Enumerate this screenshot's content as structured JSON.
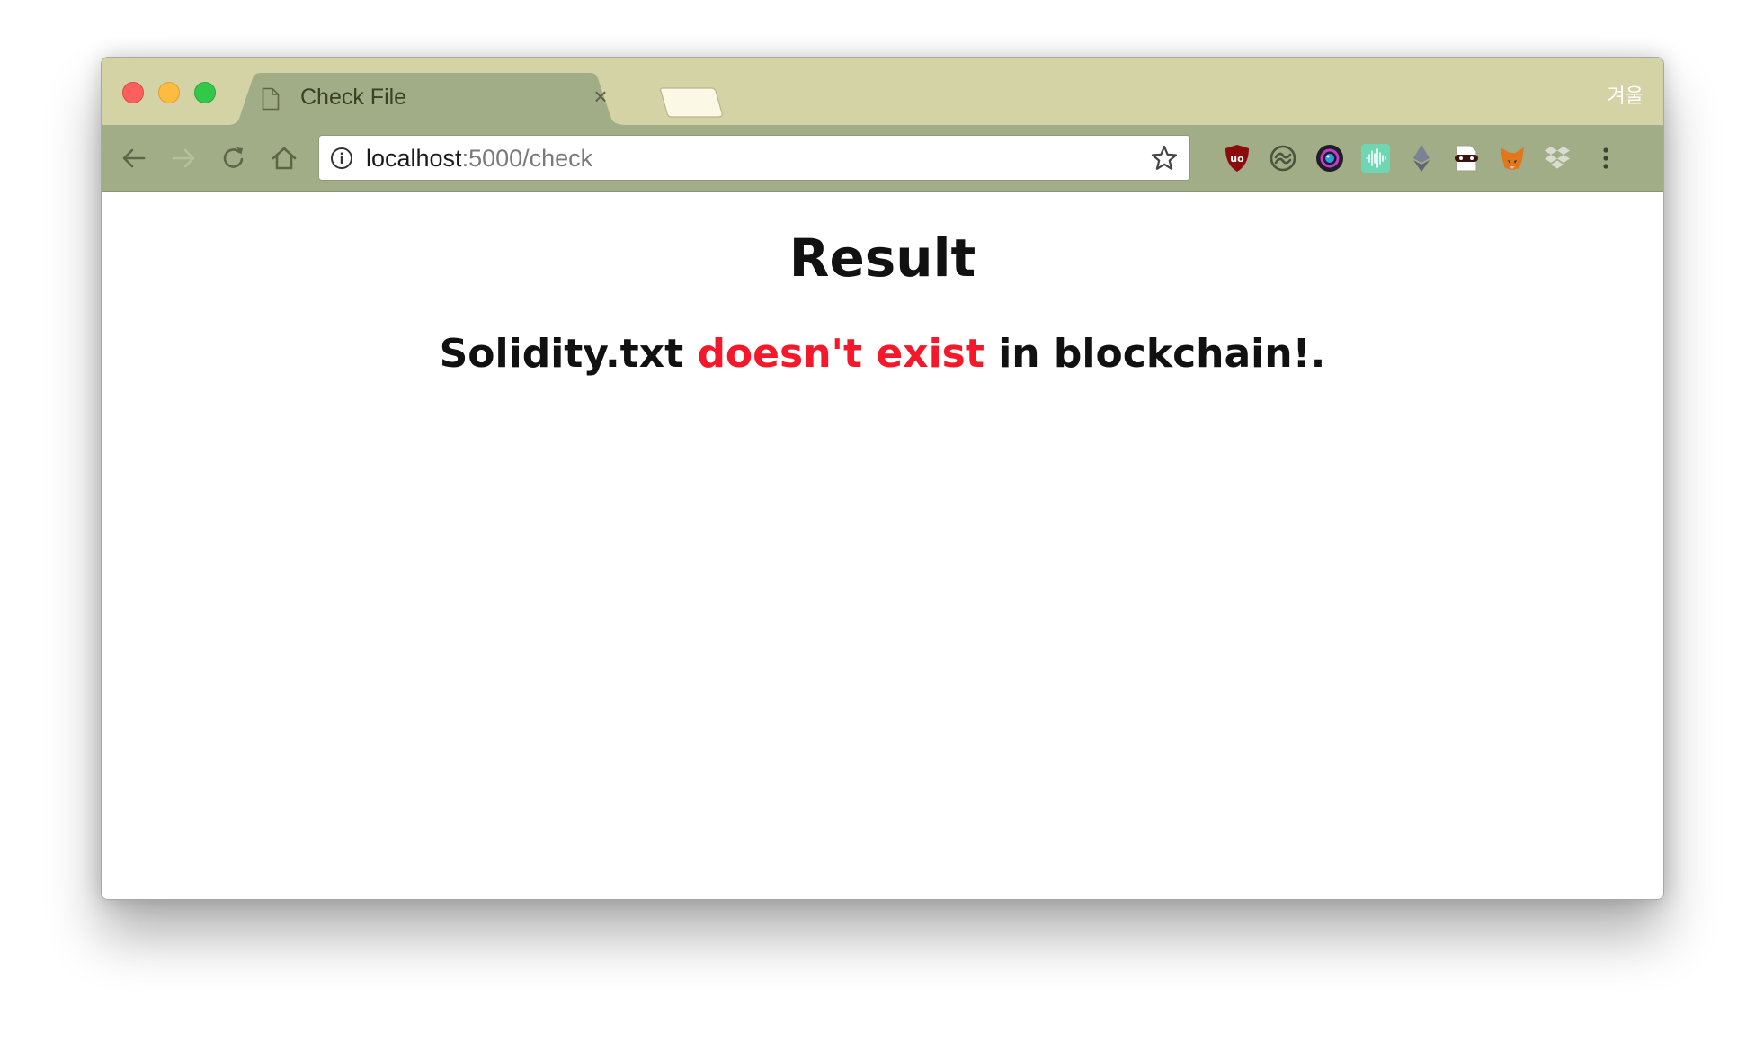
{
  "browser": {
    "tab_title": "Check File",
    "tab_close": "×",
    "profile_name": "겨울",
    "url_host": "localhost",
    "url_rest": ":5000/check",
    "icons": {
      "back": "arrow-left-icon",
      "forward": "arrow-right-icon",
      "reload": "reload-icon",
      "home": "home-icon",
      "site_info": "info-icon",
      "bookmark": "star-icon",
      "menu": "vertical-dots-icon"
    },
    "extensions": [
      "ublock-icon",
      "sync-icon",
      "camera-lens-icon",
      "audio-wave-icon",
      "ethereum-icon",
      "masked-extension-icon",
      "metamask-fox-icon",
      "dropbox-icon"
    ],
    "colors": {
      "tabstrip": "#d4d3a6",
      "toolbar": "#a1ad87",
      "active_tab": "#a1ad87",
      "new_tab": "#fbf8e6"
    }
  },
  "page": {
    "heading": "Result",
    "message_filename": "Solidity.txt",
    "message_status": "doesn't exist",
    "message_suffix": "in blockchain!.",
    "status_color": "#f5182a"
  }
}
